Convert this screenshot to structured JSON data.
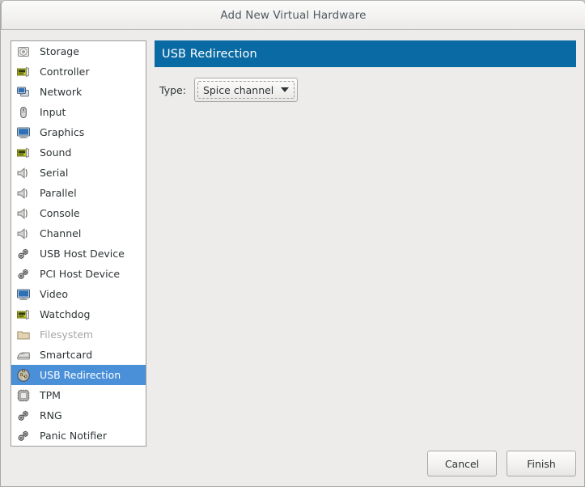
{
  "window": {
    "title": "Add New Virtual Hardware",
    "accent_color": "#0a6ba4",
    "selection_color": "#4a90d9",
    "background_color": "#edecea"
  },
  "sidebar": {
    "items": [
      {
        "label": "Storage",
        "icon": "storage-icon",
        "selected": false,
        "disabled": false
      },
      {
        "label": "Controller",
        "icon": "controller-icon",
        "selected": false,
        "disabled": false
      },
      {
        "label": "Network",
        "icon": "network-icon",
        "selected": false,
        "disabled": false
      },
      {
        "label": "Input",
        "icon": "mouse-icon",
        "selected": false,
        "disabled": false
      },
      {
        "label": "Graphics",
        "icon": "display-icon",
        "selected": false,
        "disabled": false
      },
      {
        "label": "Sound",
        "icon": "soundcard-icon",
        "selected": false,
        "disabled": false
      },
      {
        "label": "Serial",
        "icon": "serial-port-icon",
        "selected": false,
        "disabled": false
      },
      {
        "label": "Parallel",
        "icon": "parallel-port-icon",
        "selected": false,
        "disabled": false
      },
      {
        "label": "Console",
        "icon": "console-icon",
        "selected": false,
        "disabled": false
      },
      {
        "label": "Channel",
        "icon": "channel-icon",
        "selected": false,
        "disabled": false
      },
      {
        "label": "USB Host Device",
        "icon": "usb-host-gears-icon",
        "selected": false,
        "disabled": false
      },
      {
        "label": "PCI Host Device",
        "icon": "pci-host-gears-icon",
        "selected": false,
        "disabled": false
      },
      {
        "label": "Video",
        "icon": "video-monitor-icon",
        "selected": false,
        "disabled": false
      },
      {
        "label": "Watchdog",
        "icon": "watchdog-card-icon",
        "selected": false,
        "disabled": false
      },
      {
        "label": "Filesystem",
        "icon": "folder-icon",
        "selected": false,
        "disabled": true
      },
      {
        "label": "Smartcard",
        "icon": "smartcard-icon",
        "selected": false,
        "disabled": false
      },
      {
        "label": "USB Redirection",
        "icon": "usb-redir-icon",
        "selected": true,
        "disabled": false
      },
      {
        "label": "TPM",
        "icon": "chip-icon",
        "selected": false,
        "disabled": false
      },
      {
        "label": "RNG",
        "icon": "rng-gears-icon",
        "selected": false,
        "disabled": false
      },
      {
        "label": "Panic Notifier",
        "icon": "panic-gears-icon",
        "selected": false,
        "disabled": false
      }
    ]
  },
  "main": {
    "header_title": "USB Redirection",
    "type_label": "Type:",
    "type_value": "Spice channel",
    "type_options": [
      "Spice channel"
    ],
    "dropdown_arrow": "chevron-down-icon"
  },
  "footer": {
    "cancel_label": "Cancel",
    "finish_label": "Finish"
  }
}
